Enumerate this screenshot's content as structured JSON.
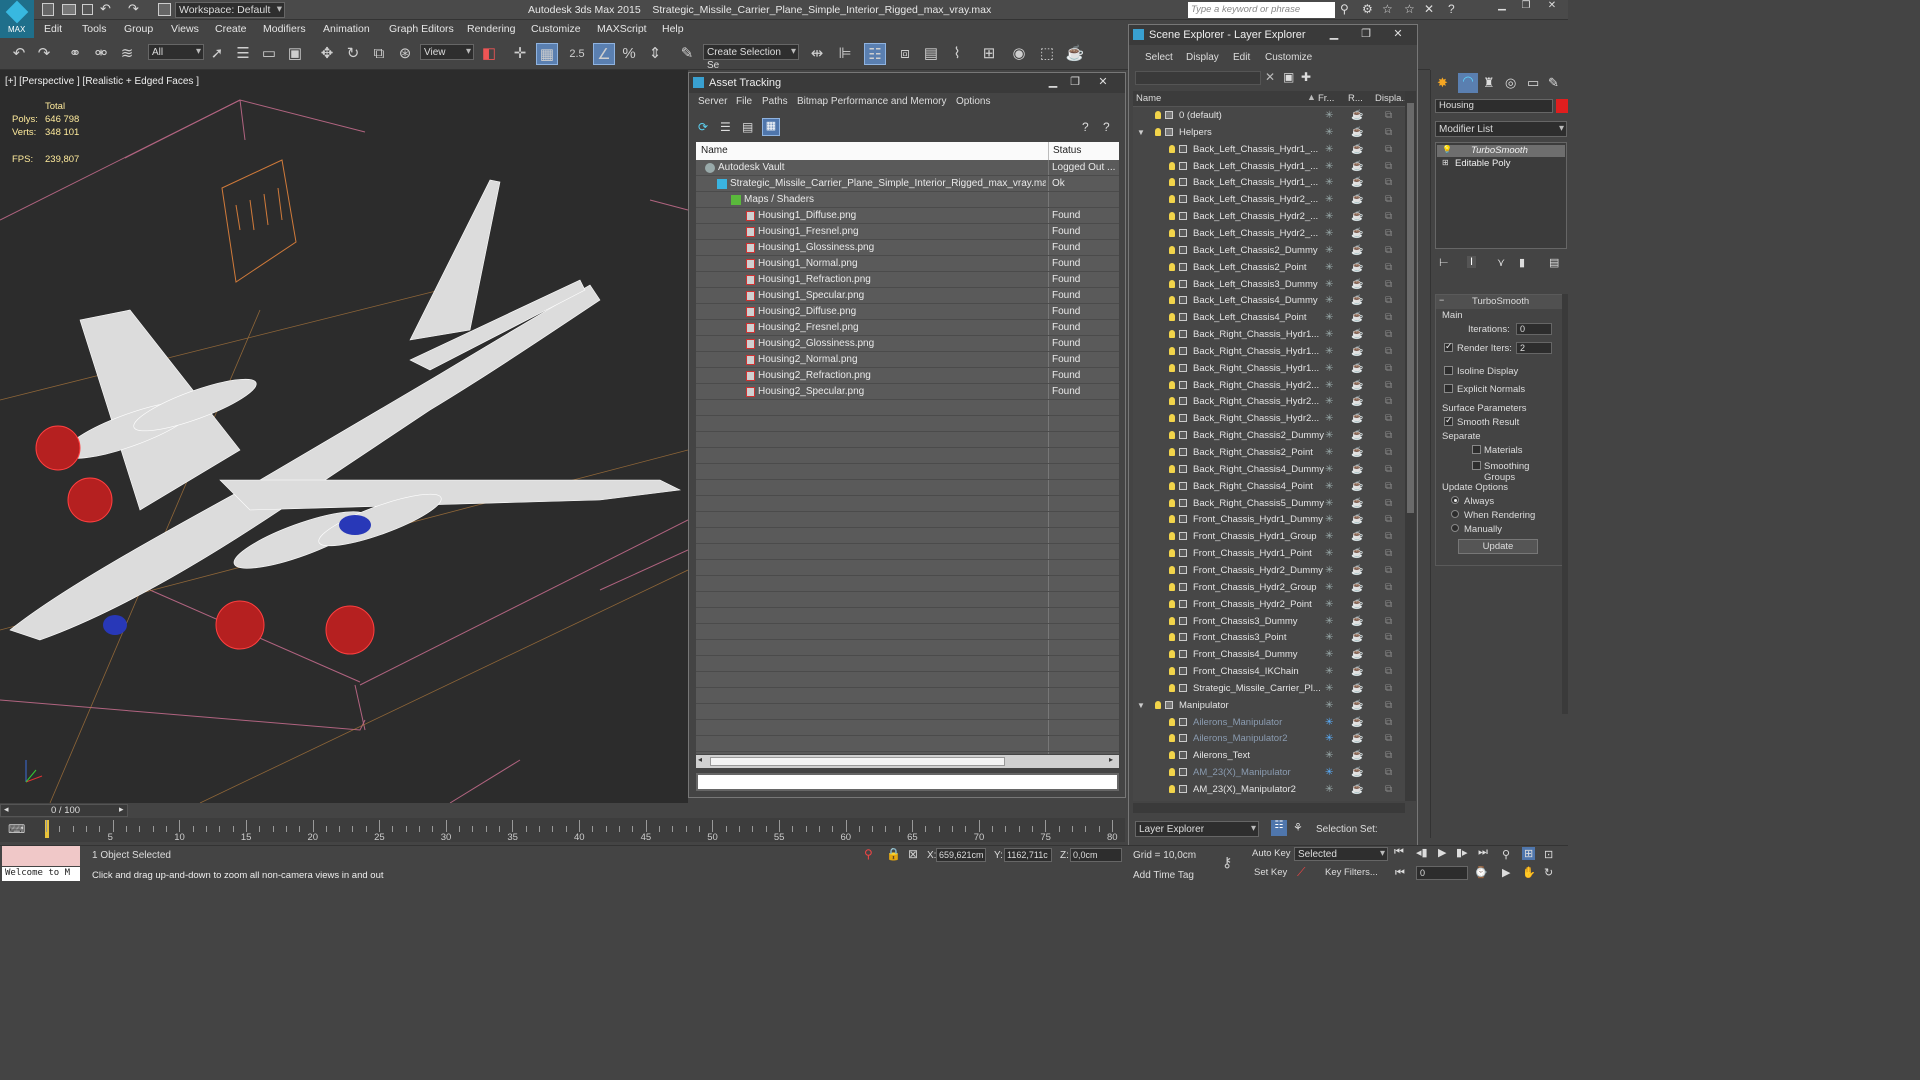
{
  "app": {
    "title": "Autodesk 3ds Max 2015    Strategic_Missile_Carrier_Plane_Simple_Interior_Rigged_max_vray.max",
    "logo_label": "MAX",
    "workspace": "Workspace: Default",
    "search_placeholder": "Type a keyword or phrase"
  },
  "menu": [
    "Edit",
    "Tools",
    "Group",
    "Views",
    "Create",
    "Modifiers",
    "Animation",
    "Graph Editors",
    "Rendering",
    "Customize",
    "MAXScript",
    "Help"
  ],
  "toolbar": {
    "filter": "All",
    "ref_coord": "View",
    "snap_value": "2.5",
    "selection_set": "Create Selection Se"
  },
  "viewport": {
    "label": "[+] [Perspective ] [Realistic + Edged Faces ]",
    "stats_total": "Total",
    "polys_label": "Polys:",
    "polys_value": "646 798",
    "verts_label": "Verts:",
    "verts_value": "348 101",
    "fps_label": "FPS:",
    "fps_value": "239,807"
  },
  "asset_tracking": {
    "title": "Asset Tracking",
    "menu": [
      "Server",
      "File",
      "Paths",
      "Bitmap Performance and Memory",
      "Options"
    ],
    "col_name": "Name",
    "col_status": "Status",
    "rows": [
      {
        "name": "Autodesk Vault",
        "status": "Logged Out ..."
      },
      {
        "name": "Strategic_Missile_Carrier_Plane_Simple_Interior_Rigged_max_vray.max",
        "status": "Ok"
      },
      {
        "name": "Maps / Shaders",
        "status": ""
      },
      {
        "name": "Housing1_Diffuse.png",
        "status": "Found"
      },
      {
        "name": "Housing1_Fresnel.png",
        "status": "Found"
      },
      {
        "name": "Housing1_Glossiness.png",
        "status": "Found"
      },
      {
        "name": "Housing1_Normal.png",
        "status": "Found"
      },
      {
        "name": "Housing1_Refraction.png",
        "status": "Found"
      },
      {
        "name": "Housing1_Specular.png",
        "status": "Found"
      },
      {
        "name": "Housing2_Diffuse.png",
        "status": "Found"
      },
      {
        "name": "Housing2_Fresnel.png",
        "status": "Found"
      },
      {
        "name": "Housing2_Glossiness.png",
        "status": "Found"
      },
      {
        "name": "Housing2_Normal.png",
        "status": "Found"
      },
      {
        "name": "Housing2_Refraction.png",
        "status": "Found"
      },
      {
        "name": "Housing2_Specular.png",
        "status": "Found"
      }
    ]
  },
  "scene_explorer": {
    "title": "Scene Explorer - Layer Explorer",
    "menu": [
      "Select",
      "Display",
      "Edit",
      "Customize"
    ],
    "col_name": "Name",
    "col_frozen": "Fr...",
    "col_render": "R...",
    "col_display": "Displa...",
    "rows": [
      {
        "name": "0 (default)",
        "level": 0
      },
      {
        "name": "Helpers",
        "level": 0
      },
      {
        "name": "Back_Left_Chassis_Hydr1_...",
        "level": 1
      },
      {
        "name": "Back_Left_Chassis_Hydr1_...",
        "level": 1
      },
      {
        "name": "Back_Left_Chassis_Hydr1_...",
        "level": 1
      },
      {
        "name": "Back_Left_Chassis_Hydr2_...",
        "level": 1
      },
      {
        "name": "Back_Left_Chassis_Hydr2_...",
        "level": 1
      },
      {
        "name": "Back_Left_Chassis_Hydr2_...",
        "level": 1
      },
      {
        "name": "Back_Left_Chassis2_Dummy",
        "level": 1
      },
      {
        "name": "Back_Left_Chassis2_Point",
        "level": 1
      },
      {
        "name": "Back_Left_Chassis3_Dummy",
        "level": 1
      },
      {
        "name": "Back_Left_Chassis4_Dummy",
        "level": 1
      },
      {
        "name": "Back_Left_Chassis4_Point",
        "level": 1
      },
      {
        "name": "Back_Right_Chassis_Hydr1...",
        "level": 1
      },
      {
        "name": "Back_Right_Chassis_Hydr1...",
        "level": 1
      },
      {
        "name": "Back_Right_Chassis_Hydr1...",
        "level": 1
      },
      {
        "name": "Back_Right_Chassis_Hydr2...",
        "level": 1
      },
      {
        "name": "Back_Right_Chassis_Hydr2...",
        "level": 1
      },
      {
        "name": "Back_Right_Chassis_Hydr2...",
        "level": 1
      },
      {
        "name": "Back_Right_Chassis2_Dummy",
        "level": 1
      },
      {
        "name": "Back_Right_Chassis2_Point",
        "level": 1
      },
      {
        "name": "Back_Right_Chassis4_Dummy",
        "level": 1
      },
      {
        "name": "Back_Right_Chassis4_Point",
        "level": 1
      },
      {
        "name": "Back_Right_Chassis5_Dummy",
        "level": 1
      },
      {
        "name": "Front_Chassis_Hydr1_Dummy",
        "level": 1
      },
      {
        "name": "Front_Chassis_Hydr1_Group",
        "level": 1
      },
      {
        "name": "Front_Chassis_Hydr1_Point",
        "level": 1
      },
      {
        "name": "Front_Chassis_Hydr2_Dummy",
        "level": 1
      },
      {
        "name": "Front_Chassis_Hydr2_Group",
        "level": 1
      },
      {
        "name": "Front_Chassis_Hydr2_Point",
        "level": 1
      },
      {
        "name": "Front_Chassis3_Dummy",
        "level": 1
      },
      {
        "name": "Front_Chassis3_Point",
        "level": 1
      },
      {
        "name": "Front_Chassis4_Dummy",
        "level": 1
      },
      {
        "name": "Front_Chassis4_IKChain",
        "level": 1
      },
      {
        "name": "Strategic_Missile_Carrier_Pl...",
        "level": 1
      },
      {
        "name": "Manipulator",
        "level": 0
      },
      {
        "name": "Ailerons_Manipulator",
        "level": 1
      },
      {
        "name": "Ailerons_Manipulator2",
        "level": 1
      },
      {
        "name": "Ailerons_Text",
        "level": 1
      },
      {
        "name": "AM_23(X)_Manipulator",
        "level": 1
      },
      {
        "name": "AM_23(X)_Manipulator2",
        "level": 1
      }
    ],
    "footer_mode": "Layer Explorer",
    "selection_set_label": "Selection Set:"
  },
  "command_panel": {
    "object_name": "Housing",
    "modifier_list": "Modifier List",
    "stack": [
      "TurboSmooth",
      "Editable Poly"
    ],
    "rollout_title": "TurboSmooth",
    "main_label": "Main",
    "iterations_label": "Iterations:",
    "iterations_value": "0",
    "render_iters_label": "Render Iters:",
    "render_iters_value": "2",
    "isoline_label": "Isoline Display",
    "explicit_normals_label": "Explicit Normals",
    "surface_params_label": "Surface Parameters",
    "smooth_result_label": "Smooth Result",
    "separate_label": "Separate",
    "materials_label": "Materials",
    "smoothing_groups_label": "Smoothing Groups",
    "update_options_label": "Update Options",
    "always_label": "Always",
    "when_rendering_label": "When Rendering",
    "manually_label": "Manually",
    "update_button": "Update"
  },
  "timeline": {
    "frame_display": "0 / 100",
    "ticks": [
      "5",
      "10",
      "15",
      "20",
      "25",
      "30",
      "35",
      "40",
      "45",
      "50",
      "55",
      "60",
      "65",
      "70",
      "75",
      "80"
    ]
  },
  "status": {
    "maxscript": "Welcome to M",
    "selected": "1 Object Selected",
    "prompt": "Click and drag up-and-down to zoom all non-camera views in and out",
    "x_label": "X:",
    "x_value": "659,621cm",
    "y_label": "Y:",
    "y_value": "1162,711c",
    "z_label": "Z:",
    "z_value": "0,0cm",
    "grid": "Grid = 10,0cm",
    "add_time_tag": "Add Time Tag",
    "auto_key": "Auto Key",
    "selected_combo": "Selected",
    "set_key": "Set Key",
    "key_filters": "Key Filters...",
    "frame_value": "0"
  }
}
